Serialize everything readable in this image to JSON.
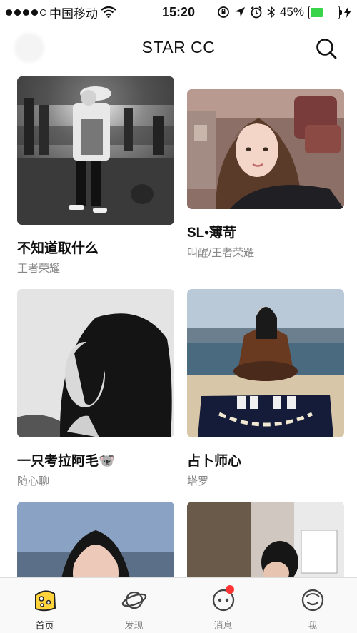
{
  "status_bar": {
    "carrier": "中国移动",
    "time": "15:20",
    "battery": "45%",
    "battery_level": 0.45
  },
  "header": {
    "title": "STAR CC"
  },
  "feed": {
    "cards": [
      {
        "name": "不知道取什么",
        "tag": "王者荣耀"
      },
      {
        "name": "SL•薄苛",
        "tag": "叫醒/王者荣耀"
      },
      {
        "name": "一只考拉阿毛🐨",
        "tag": "随心聊"
      },
      {
        "name": "占卜师心",
        "tag": "塔罗"
      }
    ]
  },
  "tab_bar": {
    "tabs": [
      {
        "label": "首页",
        "icon": "home-cheese-icon",
        "active": true
      },
      {
        "label": "发现",
        "icon": "planet-icon",
        "active": false
      },
      {
        "label": "消息",
        "icon": "message-bubble-icon",
        "active": false,
        "badge": true
      },
      {
        "label": "我",
        "icon": "profile-face-icon",
        "active": false
      }
    ]
  },
  "colors": {
    "accent": "#ffd33a",
    "badge": "#ff3333",
    "battery": "#3ad44a"
  }
}
